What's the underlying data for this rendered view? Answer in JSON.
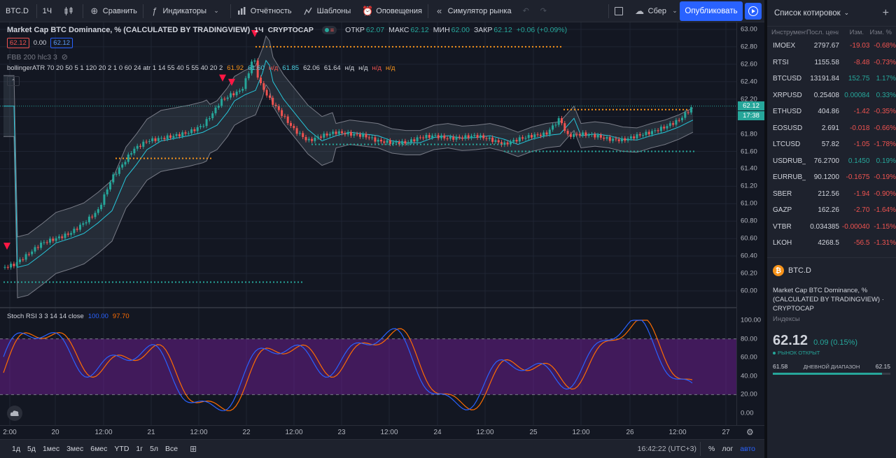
{
  "toolbar": {
    "symbol": "BTC.D",
    "interval": "1Ч",
    "compare": "Сравнить",
    "indicators": "Индикаторы",
    "financials": "Отчётность",
    "templates": "Шаблоны",
    "alerts": "Оповещения",
    "replay": "Симулятор рынка",
    "layout": "Сбер",
    "publish": "Опубликовать"
  },
  "legend": {
    "title": "Market Cap BTC Dominance, % (CALCULATED BY TRADINGVIEW)",
    "interval": "1Ч",
    "exchange": "CRYPTOCAP",
    "open_label": "ОТКР",
    "open": "62.07",
    "high_label": "МАКС",
    "high": "62.12",
    "low_label": "МИН",
    "low": "62.00",
    "close_label": "ЗАКР",
    "close": "62.12",
    "change": "+0.06 (+0.09%)",
    "bid": "62.12",
    "spread": "0.00",
    "ask": "62.12",
    "fbb": "FBB 200 hlc3 3",
    "boll_name": "bollingerATR 70 20 50 5 1 120 20 2 1 0 60 24 atr 1 14 55 40 5 55 40 20 2",
    "boll_v1": "61.92",
    "boll_v2": "61.60",
    "boll_na1": "н/д",
    "boll_v3": "61.85",
    "boll_v4": "62.06",
    "boll_v5": "61.64",
    "boll_na2": "н/д",
    "boll_na3": "н/д",
    "boll_na4": "н/д",
    "boll_na5": "н/д",
    "stoch_name": "Stoch RSI 3 3 14 14 close",
    "stoch_k": "100.00",
    "stoch_d": "97.70"
  },
  "price_axis": {
    "ticks": [
      "63.00",
      "62.80",
      "62.60",
      "62.40",
      "62.20",
      "62.00",
      "61.80",
      "61.60",
      "61.40",
      "61.20",
      "61.00",
      "60.80",
      "60.60",
      "60.40",
      "60.20",
      "60.00"
    ],
    "current_price": "62.12",
    "countdown": "17:38",
    "stoch_ticks": [
      "100.00",
      "80.00",
      "60.00",
      "40.00",
      "20.00",
      "0.00"
    ]
  },
  "time_axis": {
    "ticks": [
      "2:00",
      "20",
      "12:00",
      "21",
      "12:00",
      "22",
      "12:00",
      "23",
      "12:00",
      "24",
      "12:00",
      "25",
      "12:00",
      "26",
      "12:00",
      "27"
    ]
  },
  "bottom_bar": {
    "ranges": [
      "1д",
      "5д",
      "1мес",
      "3мес",
      "6мес",
      "YTD",
      "1г",
      "5л",
      "Все"
    ],
    "time": "16:42:22 (UTC+3)",
    "pct": "%",
    "log": "лог",
    "auto": "авто"
  },
  "watchlist": {
    "title": "Список котировок",
    "col_symbol": "Инструмент",
    "col_last": "Посл. цена",
    "col_chg": "Изм.",
    "col_pct": "Изм. %",
    "rows": [
      {
        "symbol": "IMOEX",
        "last": "2797.67",
        "chg": "-19.03",
        "pct": "-0.68%",
        "dir": "down"
      },
      {
        "symbol": "RTSI",
        "last": "1155.58",
        "chg": "-8.48",
        "pct": "-0.73%",
        "dir": "down"
      },
      {
        "symbol": "BTCUSD",
        "last": "13191.84",
        "chg": "152.75",
        "pct": "1.17%",
        "dir": "up"
      },
      {
        "symbol": "XRPUSD",
        "last": "0.25408",
        "chg": "0.00084",
        "pct": "0.33%",
        "dir": "up"
      },
      {
        "symbol": "ETHUSD",
        "last": "404.86",
        "chg": "-1.42",
        "pct": "-0.35%",
        "dir": "down"
      },
      {
        "symbol": "EOSUSD",
        "last": "2.691",
        "chg": "-0.018",
        "pct": "-0.66%",
        "dir": "down"
      },
      {
        "symbol": "LTCUSD",
        "last": "57.82",
        "chg": "-1.05",
        "pct": "-1.78%",
        "dir": "down"
      },
      {
        "symbol": "USDRUB_TOM",
        "last": "76.2700",
        "chg": "0.1450",
        "pct": "0.19%",
        "dir": "up"
      },
      {
        "symbol": "EURRUB_TOM",
        "last": "90.1200",
        "chg": "-0.1675",
        "pct": "-0.19%",
        "dir": "down"
      },
      {
        "symbol": "SBER",
        "last": "212.56",
        "chg": "-1.94",
        "pct": "-0.90%",
        "dir": "down"
      },
      {
        "symbol": "GAZP",
        "last": "162.26",
        "chg": "-2.70",
        "pct": "-1.64%",
        "dir": "down"
      },
      {
        "symbol": "VTBR",
        "last": "0.034385",
        "chg": "-0.00040",
        "pct": "-1.15%",
        "dir": "down"
      },
      {
        "symbol": "LKOH",
        "last": "4268.5",
        "chg": "-56.5",
        "pct": "-1.31%",
        "dir": "down"
      }
    ]
  },
  "details": {
    "symbol": "BTC.D",
    "description": "Market Cap BTC Dominance, % (CALCULATED BY TRADINGVIEW) · CRYPTOCAP",
    "category": "Индексы",
    "price": "62.12",
    "change": "0.09 (0.15%)",
    "status": "РЫНОК ОТКРЫТ",
    "range_low": "61.58",
    "range_label": "ДНЕВНОЙ ДИАПАЗОН",
    "range_high": "62.15",
    "range_position": 0.93
  },
  "colors": {
    "bg": "#131722",
    "panel": "#1e222d",
    "up": "#26a69a",
    "down": "#ef5350",
    "accent": "#2962ff",
    "stoch_k": "#2962ff",
    "stoch_d": "#ff6d00",
    "stoch_band": "#7b1fa2"
  }
}
